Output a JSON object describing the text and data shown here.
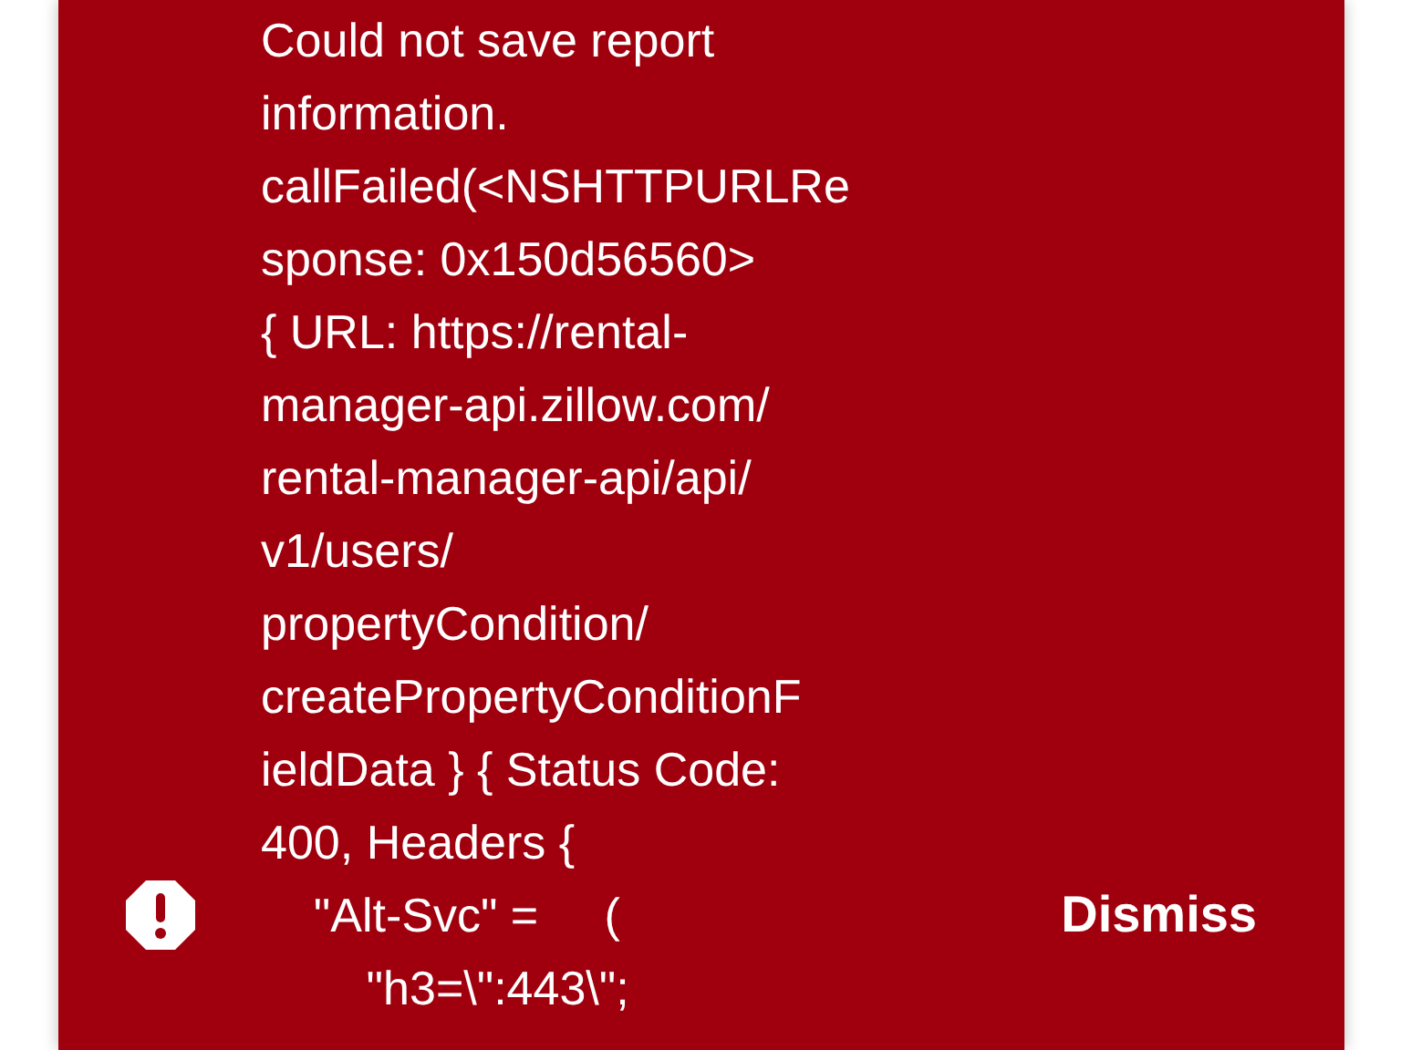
{
  "alert": {
    "message_lines": [
      "Could not save report",
      "information.",
      "callFailed(<NSHTTPURLRe",
      "sponse: 0x150d56560>",
      "{ URL: https://rental-",
      "manager-api.zillow.com/",
      "rental-manager-api/api/",
      "v1/users/",
      "propertyCondition/",
      "createPropertyConditionF",
      "ieldData } { Status Code:",
      "400, Headers {",
      "    \"Alt-Svc\" =     (",
      "        \"h3=\\\":443\\\";"
    ],
    "dismiss": "Dismiss"
  }
}
